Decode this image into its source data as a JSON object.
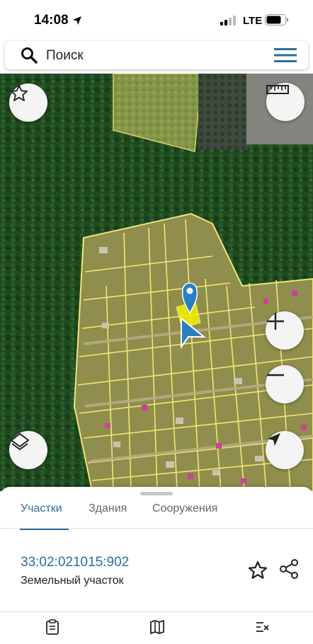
{
  "status_bar": {
    "time": "14:08",
    "network": "LTE"
  },
  "search": {
    "placeholder": "Поиск"
  },
  "map": {
    "controls": [
      "star-icon",
      "ruler-icon",
      "zoom-in-icon",
      "zoom-out-icon",
      "layers-icon",
      "navigation-icon"
    ],
    "colors": {
      "forest": "#1f4a20",
      "plot_fill": "#8f8e4c",
      "plot_border": "#f2e57a",
      "selected_plot": "#f5f000",
      "marker": "#2a7fc4",
      "location_arrow": "#2b7ec2"
    }
  },
  "sheet": {
    "tabs": [
      {
        "label": "Участки",
        "active": true
      },
      {
        "label": "Здания",
        "active": false
      },
      {
        "label": "Сооружения",
        "active": false
      }
    ],
    "parcel": {
      "number": "33:02:021015:902",
      "type": "Земельный участок"
    },
    "accent_color": "#2a6f9e"
  },
  "bottom_nav": {
    "items": [
      {
        "icon": "clipboard-icon"
      },
      {
        "icon": "map-icon"
      },
      {
        "icon": "route-icon"
      }
    ]
  }
}
